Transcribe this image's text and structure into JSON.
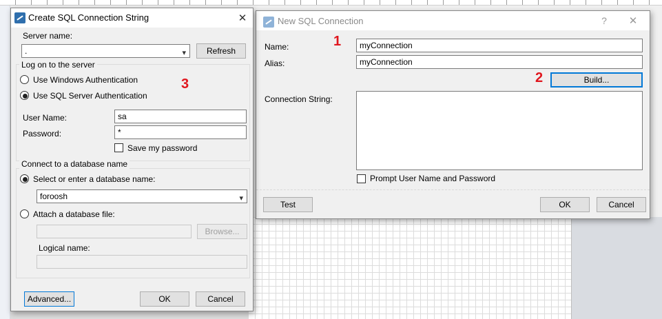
{
  "right_dialog": {
    "title": "New SQL Connection",
    "help_button": "?",
    "close_button": "✕",
    "name_label": "Name:",
    "name_value": "myConnection",
    "alias_label": "Alias:",
    "alias_value": "myConnection",
    "build_label": "Build...",
    "connection_string_label": "Connection String:",
    "connection_string_value": "",
    "prompt_label": "Prompt User Name and Password",
    "test_label": "Test",
    "ok_label": "OK",
    "cancel_label": "Cancel"
  },
  "left_dialog": {
    "title": "Create SQL Connection String",
    "close_button": "✕",
    "server_name_label": "Server name:",
    "server_name_value": ".",
    "refresh_label": "Refresh",
    "logon_group": "Log on to the server",
    "windows_auth_label": "Use Windows Authentication",
    "sql_auth_label": "Use SQL Server Authentication",
    "username_label": "User Name:",
    "username_value": "sa",
    "password_label": "Password:",
    "password_value": "*",
    "save_password_label": "Save my password",
    "database_group": "Connect to a database name",
    "select_db_label": "Select or enter a database name:",
    "db_name_value": "foroosh",
    "attach_label": "Attach a database file:",
    "attach_value": "",
    "browse_label": "Browse...",
    "logical_name_label": "Logical name:",
    "logical_name_value": "",
    "advanced_label": "Advanced...",
    "ok_label": "OK",
    "cancel_label": "Cancel"
  },
  "annotations": {
    "marker1": "1",
    "marker2": "2",
    "marker3": "3"
  },
  "icons": {
    "dropdown": "▾",
    "app": "sql-connection-icon"
  },
  "colors": {
    "marker": "#e0161e",
    "focus": "#0078d7"
  }
}
